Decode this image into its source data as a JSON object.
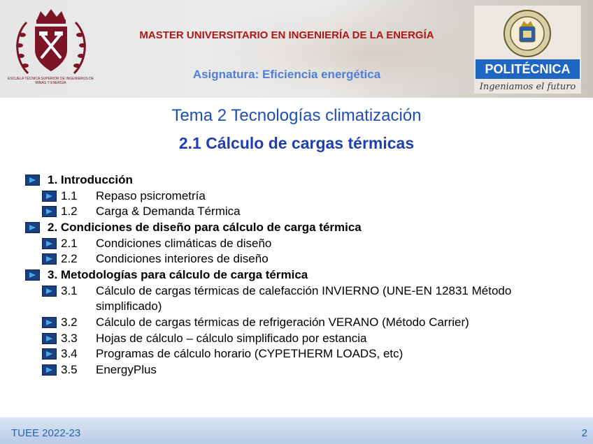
{
  "header": {
    "master": "MASTER UNIVERSITARIO EN INGENIERÍA DE LA ENERGÍA",
    "asignatura": "Asignatura: Eficiencia energética",
    "left_logo_text": "ESCUELA TÉCNICA SUPERIOR DE INGENIEROS DE MINAS Y ENERGÍA",
    "upm_badge": "POLITÉCNICA",
    "upm_slogan": "Ingeniamos el futuro"
  },
  "slide": {
    "title": "Tema 2 Tecnologías climatización",
    "subtitle": "2.1 Cálculo de cargas térmicas"
  },
  "outline": [
    {
      "level": 1,
      "num": "",
      "text": "1. Introducción"
    },
    {
      "level": 2,
      "num": "1.1",
      "text": "Repaso psicrometría"
    },
    {
      "level": 2,
      "num": "1.2",
      "text": "Carga & Demanda Térmica"
    },
    {
      "level": 1,
      "num": "",
      "text": "2. Condiciones de diseño para cálculo de carga térmica"
    },
    {
      "level": 2,
      "num": "2.1",
      "text": "Condiciones climáticas de diseño"
    },
    {
      "level": 2,
      "num": "2.2",
      "text": "Condiciones interiores de diseño"
    },
    {
      "level": 1,
      "num": "",
      "text": "3. Metodologías para cálculo de carga térmica"
    },
    {
      "level": 2,
      "num": "3.1",
      "text": "Cálculo de cargas térmicas de calefacción INVIERNO (UNE-EN 12831 Método",
      "cont": "simplificado)"
    },
    {
      "level": 2,
      "num": "3.2",
      "text": "Cálculo de cargas térmicas de refrigeración VERANO (Método Carrier)"
    },
    {
      "level": 2,
      "num": "3.3",
      "text": "Hojas de cálculo – cálculo simplificado por estancia"
    },
    {
      "level": 2,
      "num": "3.4",
      "text": "Programas de cálculo horario (CYPETHERM LOADS, etc)"
    },
    {
      "level": 2,
      "num": "3.5",
      "text": "EnergyPlus"
    }
  ],
  "footer": {
    "left": "TUEE 2022-23",
    "page": "2"
  },
  "colors": {
    "master": "#b01616",
    "asignatura": "#4f7fd6",
    "title": "#1f4fb5",
    "subtitle": "#1e3fb0",
    "bullet": "#1a3f82",
    "upm_badge": "#1f66c2"
  }
}
